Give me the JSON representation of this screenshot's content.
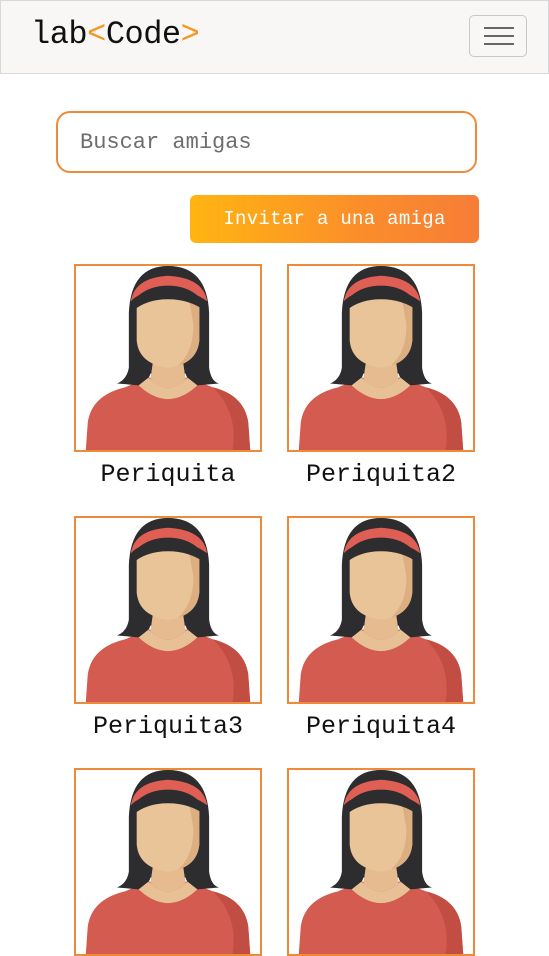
{
  "navbar": {
    "brand_left": "lab",
    "brand_lt": "<",
    "brand_mid": "Code",
    "brand_gt": ">",
    "menu_icon": "hamburger-icon"
  },
  "search": {
    "placeholder": "Buscar amigas",
    "value": ""
  },
  "invite_button": {
    "label": "Invitar a una amiga"
  },
  "friends": [
    {
      "name": "Periquita",
      "avatar": "woman-avatar-icon"
    },
    {
      "name": "Periquita2",
      "avatar": "woman-avatar-icon"
    },
    {
      "name": "Periquita3",
      "avatar": "woman-avatar-icon"
    },
    {
      "name": "Periquita4",
      "avatar": "woman-avatar-icon"
    },
    {
      "name": "",
      "avatar": "woman-avatar-icon"
    },
    {
      "name": "",
      "avatar": "woman-avatar-icon"
    }
  ],
  "colors": {
    "accent": "#f08a3b",
    "button_start": "#ffb511",
    "button_end": "#f77d37",
    "navbar_bg": "#f8f7f5"
  }
}
